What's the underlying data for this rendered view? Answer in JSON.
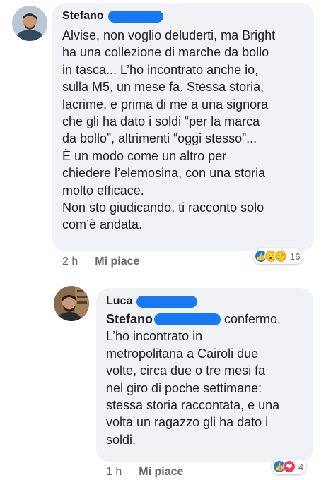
{
  "comment1": {
    "author": "Stefano",
    "text_lines": [
      "Alvise, non voglio deluderti, ma Bright",
      "ha una collezione di marche da bollo",
      "in tasca... L’ho incontrato anche io,",
      "sulla M5, un mese fa. Stessa storia,",
      "lacrime, e prima di me a una signora",
      "che gli ha dato i soldi “per la marca",
      "da bollo”, altrimenti “oggi stesso”...",
      "È un modo come un altro per",
      "chiedere l’elemosina, con una storia",
      "molto efficace.",
      "Non sto giudicando, ti racconto solo",
      "com’è andata."
    ],
    "time": "2 h",
    "like_label": "Mi piace",
    "reaction_count": "16",
    "reactions": [
      "like",
      "wow",
      "sad"
    ]
  },
  "reply1": {
    "author": "Luca",
    "mention": "Stefano",
    "first_line_rest": " confermo.",
    "text_lines": [
      "L’ho incontrato in",
      "metropolitana a Cairoli due",
      "volte, circa due o tre mesi fa",
      "nel giro di poche settimane:",
      "stessa storia raccontata, e una",
      "volta un ragazzo gli ha dato i",
      "soldi."
    ],
    "time": "1 h",
    "like_label": "Mi piace",
    "reaction_count": "4",
    "reactions": [
      "like",
      "love"
    ]
  },
  "colors": {
    "bubble": "#f0f2f5",
    "like_blue": "#1877f2",
    "love_red": "#f33e58",
    "wow_yellow": "#f7b125",
    "meta_gray": "#65676b"
  }
}
